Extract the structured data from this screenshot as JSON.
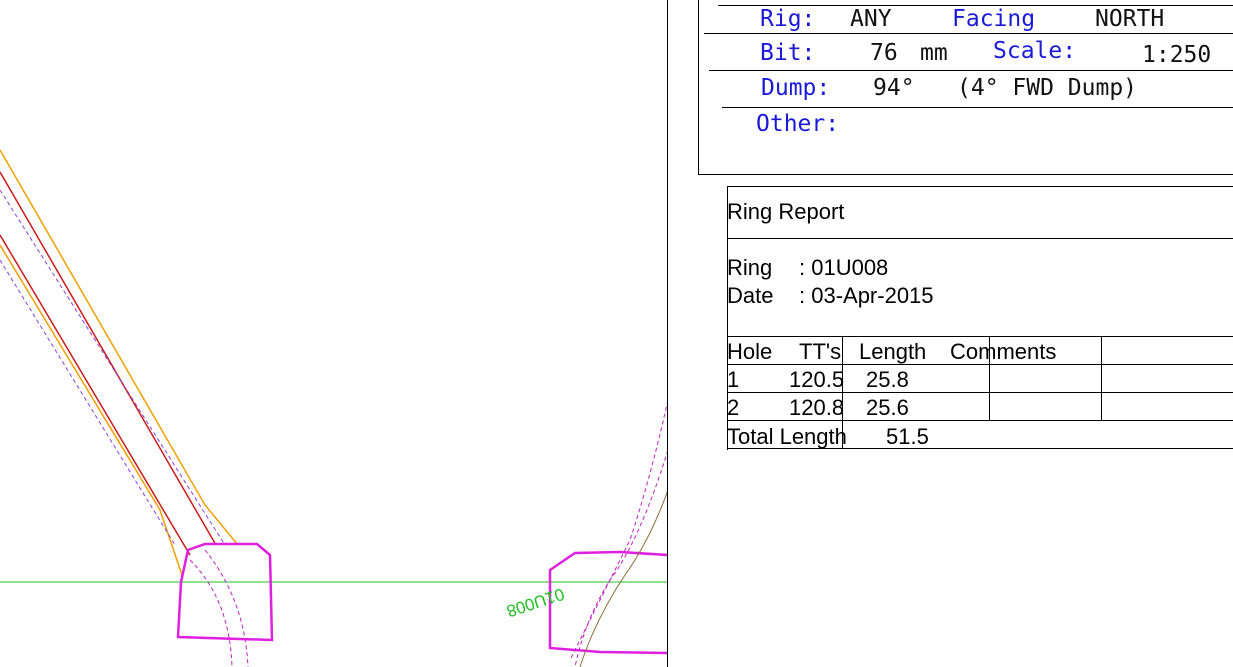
{
  "header": {
    "rig_label": "Rig:",
    "rig_value": "ANY",
    "facing_label": "Facing",
    "facing_value": "NORTH",
    "bit_label": "Bit:",
    "bit_value": "76",
    "bit_unit": "mm",
    "scale_label": "Scale:",
    "scale_value": "1:250",
    "dump_label": "Dump:",
    "dump_value": "94°",
    "dump_note": "(4° FWD Dump)",
    "other_label": "Other:"
  },
  "ring_report": {
    "title": "Ring Report",
    "ring_label": "Ring",
    "ring_value": ": 01U008",
    "date_label": "Date",
    "date_value": ": 03-Apr-2015",
    "columns": [
      "Hole",
      "TT's",
      "Length",
      "Comments"
    ],
    "rows": [
      {
        "hole": "1",
        "tt": "120.5",
        "length": "25.8"
      },
      {
        "hole": "2",
        "tt": "120.8",
        "length": "25.6"
      }
    ],
    "total_label": "Total Length",
    "total_value": "51.5"
  },
  "drawing": {
    "ring_id_label": "01U008",
    "colors": {
      "hole_outline": "#f0a000",
      "hole_centerline": "#cc1a1a",
      "profile": "#e020e0",
      "guide_line": "#20c020",
      "prev_profile": "#8a6a3a"
    }
  }
}
